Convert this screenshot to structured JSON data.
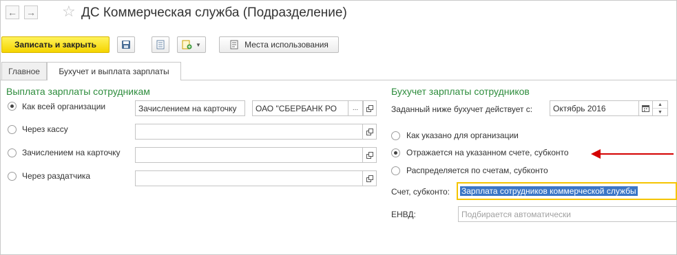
{
  "window": {
    "title": "ДС Коммерческая служба (Подразделение)"
  },
  "toolbar": {
    "save_close_label": "Записать и закрыть",
    "usage_places_label": "Места использования"
  },
  "tabs": [
    {
      "label": "Главное"
    },
    {
      "label": "Бухучет и выплата зарплаты"
    }
  ],
  "payment": {
    "title": "Выплата зарплаты сотрудникам",
    "options": [
      {
        "label": "Как всей организации",
        "checked": true,
        "value1": "Зачислением на карточку",
        "value2": "ОАО \"СБЕРБАНК РО"
      },
      {
        "label": "Через кассу",
        "checked": false
      },
      {
        "label": "Зачислением на карточку",
        "checked": false
      },
      {
        "label": "Через раздатчика",
        "checked": false
      }
    ],
    "ellipsis": "..."
  },
  "accounting": {
    "title": "Бухучет зарплаты сотрудников",
    "effective_label": "Заданный ниже бухучет действует с:",
    "effective_value": "Октябрь 2016",
    "options": [
      {
        "label": "Как указано для организации",
        "checked": false
      },
      {
        "label": "Отражается на указанном счете, субконто",
        "checked": true
      },
      {
        "label": "Распределяется по счетам, субконто",
        "checked": false
      }
    ],
    "account_label": "Счет, субконто:",
    "account_value": "Зарплата сотрудников коммерческой службы",
    "envd_label": "ЕНВД:",
    "envd_placeholder": "Подбирается автоматически"
  },
  "colors": {
    "accent_green": "#2d8c3c",
    "primary_button": "#f5d400",
    "arrow": "#d40000",
    "selection": "#3b76c6"
  }
}
